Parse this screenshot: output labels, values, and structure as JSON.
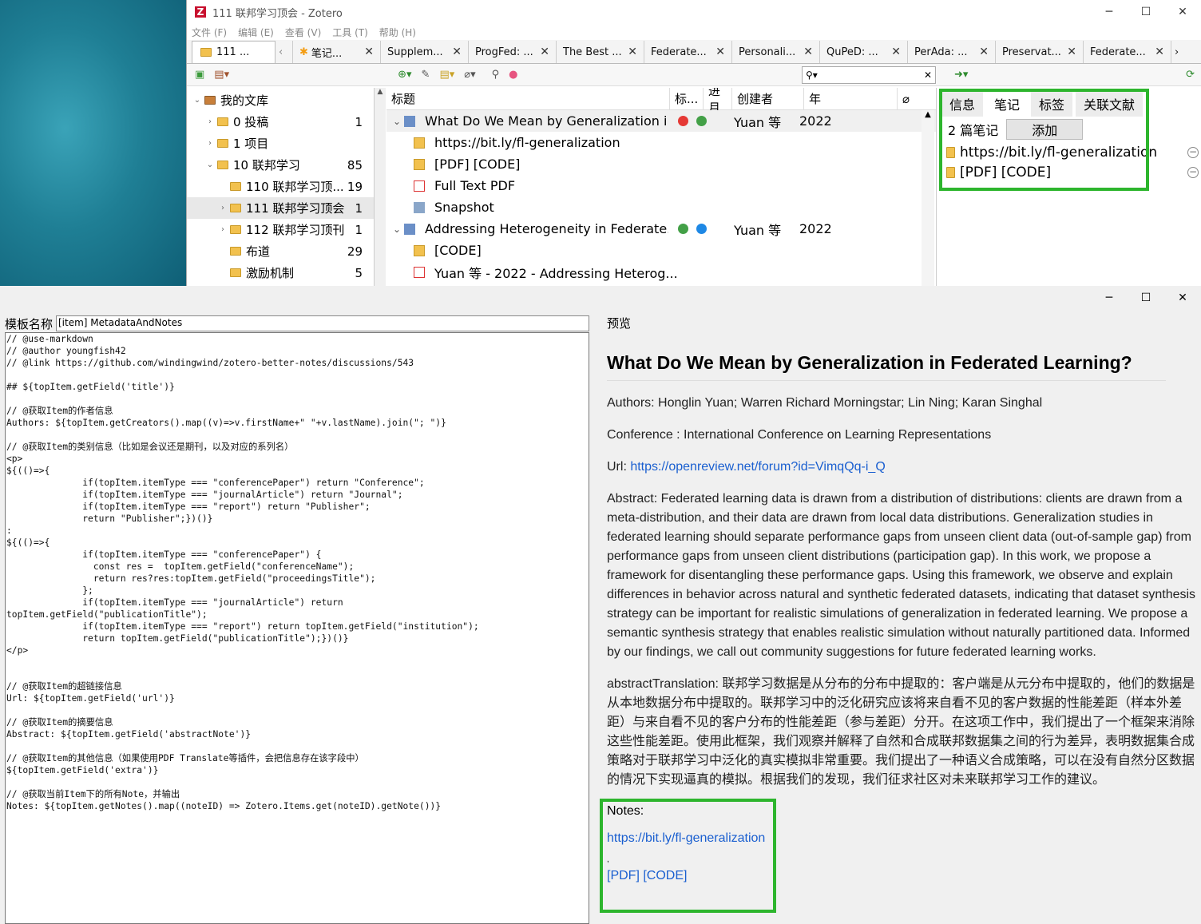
{
  "zotero": {
    "window_title": "111 联邦学习顶会 - Zotero",
    "menu": [
      "文件 (F)",
      "编辑 (E)",
      "查看 (V)",
      "工具 (T)",
      "帮助 (H)"
    ],
    "tabs": [
      {
        "label": "111 ..."
      },
      {
        "label": "笔记..."
      },
      {
        "label": "Supplem..."
      },
      {
        "label": "ProgFed: ..."
      },
      {
        "label": "The Best ..."
      },
      {
        "label": "Federate..."
      },
      {
        "label": "Personali..."
      },
      {
        "label": "QuPeD: ..."
      },
      {
        "label": "PerAda: ..."
      },
      {
        "label": "Preservat..."
      },
      {
        "label": "Federate..."
      }
    ],
    "collections": [
      {
        "label": "我的文库",
        "count": "",
        "level": 0,
        "arrow": "⌄"
      },
      {
        "label": "0 投稿",
        "count": "1",
        "level": 1,
        "arrow": "›"
      },
      {
        "label": "1 项目",
        "count": "",
        "level": 1,
        "arrow": "›"
      },
      {
        "label": "10 联邦学习",
        "count": "85",
        "level": 1,
        "arrow": "⌄"
      },
      {
        "label": "110 联邦学习顶...",
        "count": "19",
        "level": 2,
        "arrow": ""
      },
      {
        "label": "111 联邦学习顶会",
        "count": "1",
        "level": 2,
        "arrow": "›"
      },
      {
        "label": "112 联邦学习顶刊",
        "count": "1",
        "level": 2,
        "arrow": "›"
      },
      {
        "label": "布道",
        "count": "29",
        "level": 2,
        "arrow": ""
      },
      {
        "label": "激励机制",
        "count": "5",
        "level": 2,
        "arrow": ""
      }
    ],
    "columns": {
      "title": "标题",
      "tag": "标...",
      "progress": "进月",
      "creator": "创建者",
      "year": "年"
    },
    "items": [
      {
        "title": "What Do We Mean by Generalization i...",
        "creator": "Yuan 等",
        "year": "2022",
        "kind": "parent",
        "dots": [
          "#e53935",
          "#43a047"
        ]
      },
      {
        "title": "https://bit.ly/fl-generalization",
        "kind": "note"
      },
      {
        "title": "[PDF] [CODE]",
        "kind": "note"
      },
      {
        "title": "Full Text PDF",
        "kind": "pdf"
      },
      {
        "title": "Snapshot",
        "kind": "snapshot"
      },
      {
        "title": "Addressing Heterogeneity in Federate...",
        "creator": "Yuan 等",
        "year": "2022",
        "kind": "parent",
        "dots": [
          "#43a047",
          "#1e88e5"
        ]
      },
      {
        "title": "[CODE]",
        "kind": "note"
      },
      {
        "title": "Yuan 等 - 2022 - Addressing Heterog...",
        "kind": "pdf"
      }
    ],
    "right_tabs": [
      "信息",
      "笔记",
      "标签",
      "关联文献"
    ],
    "notes_count": "2 篇笔记",
    "add_button": "添加",
    "notes": [
      "https://bit.ly/fl-generalization",
      "[PDF] [CODE]"
    ]
  },
  "editor": {
    "name_label": "模板名称",
    "name_value": "[item] MetadataAndNotes",
    "code": "// @use-markdown\n// @author youngfish42\n// @link https://github.com/windingwind/zotero-better-notes/discussions/543\n\n## ${topItem.getField('title')}\n\n// @获取Item的作者信息\nAuthors: ${topItem.getCreators().map((v)=>v.firstName+\" \"+v.lastName).join(\"; \")}\n\n// @获取Item的类别信息（比如是会议还是期刊，以及对应的系列名）\n<p>\n${(()=>{\n              if(topItem.itemType === \"conferencePaper\") return \"Conference\";\n              if(topItem.itemType === \"journalArticle\") return \"Journal\";\n              if(topItem.itemType === \"report\") return \"Publisher\";\n              return \"Publisher\";})()}\n:\n${(()=>{\n              if(topItem.itemType === \"conferencePaper\") {\n                const res =  topItem.getField(\"conferenceName\");\n                return res?res:topItem.getField(\"proceedingsTitle\");\n              };\n              if(topItem.itemType === \"journalArticle\") return\ntopItem.getField(\"publicationTitle\");\n              if(topItem.itemType === \"report\") return topItem.getField(\"institution\");\n              return topItem.getField(\"publicationTitle\");})()}\n</p>\n\n\n// @获取Item的超链接信息\nUrl: ${topItem.getField('url')}\n\n// @获取Item的摘要信息\nAbstract: ${topItem.getField('abstractNote')}\n\n// @获取Item的其他信息（如果使用PDF Translate等插件，会把信息存在该字段中）\n${topItem.getField('extra')}\n\n// @获取当前Item下的所有Note，并输出\nNotes: ${topItem.getNotes().map((noteID) => Zotero.Items.get(noteID).getNote())}"
  },
  "preview": {
    "label": "预览",
    "title": "What Do We Mean by Generalization in Federated Learning?",
    "authors": "Authors: Honglin Yuan; Warren Richard Morningstar; Lin Ning; Karan Singhal",
    "conference": "Conference : International Conference on Learning Representations",
    "url_label": "Url: ",
    "url": "https://openreview.net/forum?id=VimqQq-i_Q",
    "abstract": "Abstract: Federated learning data is drawn from a distribution of distributions: clients are drawn from a meta-distribution, and their data are drawn from local data distributions. Generalization studies in federated learning should separate performance gaps from unseen client data (out-of-sample gap) from performance gaps from unseen client distributions (participation gap). In this work, we propose a framework for disentangling these performance gaps. Using this framework, we observe and explain differences in behavior across natural and synthetic federated datasets, indicating that dataset synthesis strategy can be important for realistic simulations of generalization in federated learning. We propose a semantic synthesis strategy that enables realistic simulation without naturally partitioned data. Informed by our findings, we call out community suggestions for future federated learning works.",
    "translation": "abstractTranslation: 联邦学习数据是从分布的分布中提取的：客户端是从元分布中提取的，他们的数据是从本地数据分布中提取的。联邦学习中的泛化研究应该将来自看不见的客户数据的性能差距（样本外差距）与来自看不见的客户分布的性能差距（参与差距）分开。在这项工作中，我们提出了一个框架来消除这些性能差距。使用此框架，我们观察并解释了自然和合成联邦数据集之间的行为差异，表明数据集合成策略对于联邦学习中泛化的真实模拟非常重要。我们提出了一种语义合成策略，可以在没有自然分区数据的情况下实现逼真的模拟。根据我们的发现，我们征求社区对未来联邦学习工作的建议。",
    "notes_label": "Notes:",
    "note_link": "https://bit.ly/fl-generalization",
    "comma": ",",
    "pdf_link": "[PDF]",
    "code_link": "[CODE]"
  },
  "colors": {
    "highlight_box": "#2db52d",
    "link": "#1a5fd0"
  }
}
